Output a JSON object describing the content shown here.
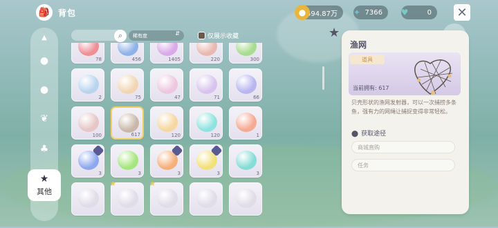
{
  "header": {
    "title": "背包"
  },
  "currencies": [
    {
      "icon": "gold-coin-icon",
      "value": "594.87万",
      "color": "#e9b63d"
    },
    {
      "icon": "blue-star-icon",
      "value": "7366",
      "color": "#6fc1d8"
    },
    {
      "icon": "heart-gem-icon",
      "value": "0",
      "color": "#79c9c4"
    }
  ],
  "sidebar": {
    "tabs": [
      {
        "name": "sidebar-tab-top",
        "icon": "arrow-up-icon"
      },
      {
        "name": "sidebar-tab-face",
        "icon": "face-icon"
      },
      {
        "name": "sidebar-tab-apple",
        "icon": "apple-icon"
      },
      {
        "name": "sidebar-tab-leaf",
        "icon": "leaf-icon"
      },
      {
        "name": "sidebar-tab-tree",
        "icon": "tree-icon"
      }
    ],
    "active_label": "其他"
  },
  "filter": {
    "sort_label": "稀有度",
    "favorites_label": "仅展示收藏"
  },
  "items": [
    {
      "count": "78",
      "color": "#ef8f95"
    },
    {
      "count": "456",
      "color": "#8fb2e8"
    },
    {
      "count": "1405",
      "color": "#d9a9e8"
    },
    {
      "count": "220",
      "color": "#e8b9b0"
    },
    {
      "count": "300",
      "color": "#a9dc8f"
    },
    {
      "count": "2",
      "color": "#b9d4ef"
    },
    {
      "count": "75",
      "color": "#f2d6b4"
    },
    {
      "count": "47",
      "color": "#ecc7df"
    },
    {
      "count": "71",
      "color": "#d8c3ef"
    },
    {
      "count": "66",
      "color": "#b9b6ef"
    },
    {
      "count": "100",
      "color": "#e6c6c6"
    },
    {
      "count": "617",
      "color": "#c9b8a8"
    },
    {
      "count": "120",
      "color": "#f5d7a0"
    },
    {
      "count": "120",
      "color": "#8fe3df"
    },
    {
      "count": "1",
      "color": "#f6a993"
    },
    {
      "count": "3",
      "color": "#8ea8ef"
    },
    {
      "count": "3",
      "color": "#a6e67e"
    },
    {
      "count": "3",
      "color": "#f5b07a"
    },
    {
      "count": "3",
      "color": "#f2e07a"
    },
    {
      "count": "3",
      "color": "#86dcd6"
    },
    {
      "count": "",
      "color": "#e0dce8"
    },
    {
      "count": "",
      "color": "#e0dce8"
    },
    {
      "count": "",
      "color": "#e0dce8"
    },
    {
      "count": "",
      "color": "#e0dce8"
    },
    {
      "count": "",
      "color": "#e0dce8"
    }
  ],
  "detail": {
    "name": "渔网",
    "category": "道具",
    "own": "当前拥有: 617",
    "description": "贝壳形状的渔网发射器，可以一次捕捞多条鱼，强有力的网绳让捕捉变得非常轻松。",
    "source_title": "获取途径",
    "sources": [
      "商城直购",
      "任务"
    ]
  }
}
